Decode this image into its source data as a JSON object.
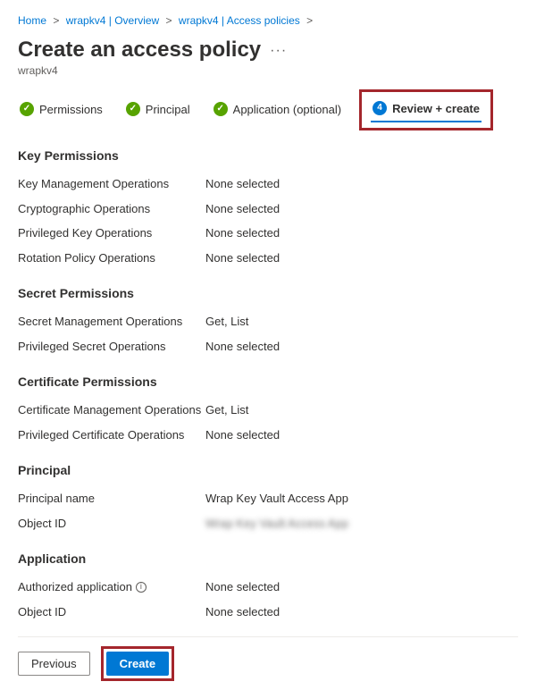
{
  "breadcrumb": {
    "items": [
      {
        "label": "Home"
      },
      {
        "label": "wrapkv4 | Overview"
      },
      {
        "label": "wrapkv4 | Access policies"
      }
    ]
  },
  "header": {
    "title": "Create an access policy",
    "subtitle": "wrapkv4"
  },
  "tabs": [
    {
      "label": "Permissions",
      "state": "done"
    },
    {
      "label": "Principal",
      "state": "done"
    },
    {
      "label": "Application (optional)",
      "state": "done"
    },
    {
      "label": "Review + create",
      "state": "active",
      "badge": "4"
    }
  ],
  "sections": {
    "key": {
      "title": "Key Permissions",
      "rows": [
        {
          "label": "Key Management Operations",
          "value": "None selected"
        },
        {
          "label": "Cryptographic Operations",
          "value": "None selected"
        },
        {
          "label": "Privileged Key Operations",
          "value": "None selected"
        },
        {
          "label": "Rotation Policy Operations",
          "value": "None selected"
        }
      ]
    },
    "secret": {
      "title": "Secret Permissions",
      "rows": [
        {
          "label": "Secret Management Operations",
          "value": "Get, List"
        },
        {
          "label": "Privileged Secret Operations",
          "value": "None selected"
        }
      ]
    },
    "cert": {
      "title": "Certificate Permissions",
      "rows": [
        {
          "label": "Certificate Management Operations",
          "value": "Get, List"
        },
        {
          "label": "Privileged Certificate Operations",
          "value": "None selected"
        }
      ]
    },
    "principal": {
      "title": "Principal",
      "rows": [
        {
          "label": "Principal name",
          "value": "Wrap Key Vault Access App"
        },
        {
          "label": "Object ID",
          "value": "Wrap Key Vault Access App",
          "blurred": true
        }
      ]
    },
    "application": {
      "title": "Application",
      "rows": [
        {
          "label": "Authorized application",
          "value": "None selected",
          "info": true
        },
        {
          "label": "Object ID",
          "value": "None selected"
        }
      ]
    }
  },
  "footer": {
    "previous": "Previous",
    "create": "Create"
  }
}
